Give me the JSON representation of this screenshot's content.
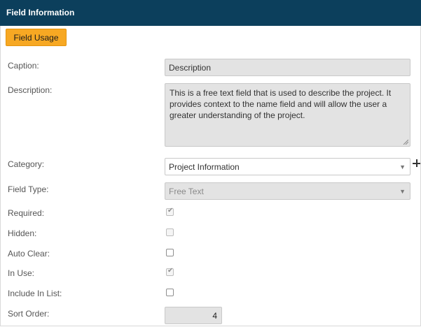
{
  "panel": {
    "title": "Field Information"
  },
  "actions": {
    "field_usage_label": "Field Usage"
  },
  "form": {
    "caption": {
      "label": "Caption:",
      "value": "Description"
    },
    "description": {
      "label": "Description:",
      "value": "This is a free text field that is used to describe the project. It provides context to the name field and will allow the user a greater understanding of the project."
    },
    "category": {
      "label": "Category:",
      "value": "Project Information"
    },
    "field_type": {
      "label": "Field Type:",
      "value": "Free Text"
    },
    "required": {
      "label": "Required:",
      "checked": true,
      "enabled": false
    },
    "hidden": {
      "label": "Hidden:",
      "checked": false,
      "enabled": false
    },
    "auto_clear": {
      "label": "Auto Clear:",
      "checked": false,
      "enabled": true
    },
    "in_use": {
      "label": "In Use:",
      "checked": true,
      "enabled": false
    },
    "include_in_list": {
      "label": "Include In List:",
      "checked": false,
      "enabled": true
    },
    "sort_order": {
      "label": "Sort Order:",
      "value": "4"
    }
  },
  "icons": {
    "add": "plus-icon",
    "dropdown": "caret-down-icon",
    "checkmark": "checkmark-icon",
    "resize": "resize-grip-icon"
  },
  "colors": {
    "header_bg": "#0c3f5c",
    "button_bg": "#f7a823",
    "disabled_field_bg": "#e3e3e3"
  }
}
